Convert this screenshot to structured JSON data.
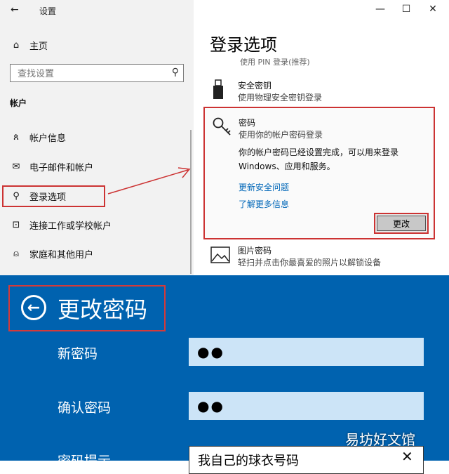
{
  "window": {
    "back_glyph": "←",
    "title": "设置",
    "minimize_glyph": "—",
    "maximize_glyph": "☐",
    "close_glyph": "✕"
  },
  "sidebar": {
    "home_label": "主页",
    "search_placeholder": "查找设置",
    "section_label": "帐户",
    "items": [
      {
        "label": "帐户信息",
        "icon": "account-info-icon",
        "glyph": "ጰ"
      },
      {
        "label": "电子邮件和帐户",
        "icon": "mail-icon",
        "glyph": "✉"
      },
      {
        "label": "登录选项",
        "icon": "key-icon",
        "glyph": "⚲"
      },
      {
        "label": "连接工作或学校帐户",
        "icon": "briefcase-icon",
        "glyph": "⊡"
      },
      {
        "label": "家庭和其他用户",
        "icon": "person-icon",
        "glyph": "⍝"
      }
    ]
  },
  "main": {
    "title": "登录选项",
    "pin_peek": "使用 PIN 登录(推荐)",
    "security_key": {
      "title": "安全密钥",
      "subtitle": "使用物理安全密钥登录"
    },
    "password": {
      "title": "密码",
      "subtitle": "使用你的帐户密码登录",
      "desc_line1": "你的帐户密码已经设置完成，可以用来登录",
      "desc_line2": "Windows、应用和服务。",
      "link1": "更新安全问题",
      "link2": "了解更多信息",
      "change_button": "更改"
    },
    "picture_password": {
      "title": "图片密码",
      "subtitle": "轻扫并点击你最喜爱的照片以解锁设备"
    }
  },
  "dialog": {
    "back_glyph": "←",
    "title": "更改密码",
    "new_password_label": "新密码",
    "new_password_value": "●●",
    "confirm_password_label": "确认密码",
    "confirm_password_value": "●●",
    "hint_label": "密码提示",
    "hint_value": "我自己的球衣号码",
    "hint_clear_glyph": "✕",
    "background_color": "#0062af"
  },
  "watermark": "易坊好文馆",
  "colors": {
    "highlight_red": "#cc3333",
    "link_blue": "#0067b8"
  }
}
